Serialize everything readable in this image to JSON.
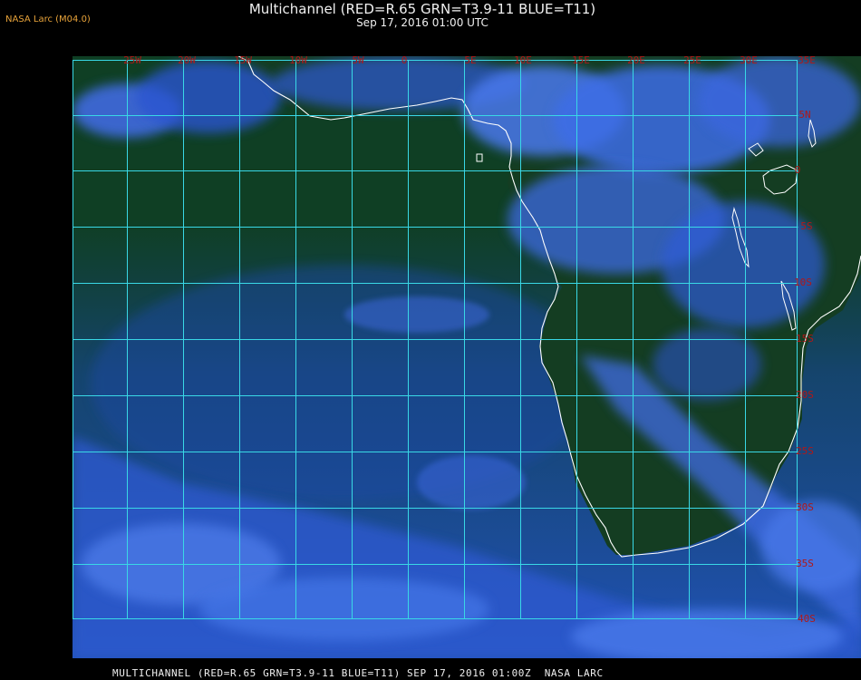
{
  "header": {
    "logo": "NASA Larc (M04.0)",
    "title": "Multichannel (RED=R.65 GRN=T3.9-11 BLUE=T11)",
    "subtitle": "Sep 17, 2016 01:00 UTC"
  },
  "map": {
    "lon_labels": [
      "25W",
      "20W",
      "15W",
      "10W",
      "5W",
      "0",
      "5E",
      "10E",
      "15E",
      "20E",
      "25E",
      "30E",
      "35E"
    ],
    "lat_labels": [
      "5N",
      "0",
      "5S",
      "10S",
      "15S",
      "20S",
      "25S",
      "30S",
      "35S",
      "40S"
    ],
    "colors": {
      "ocean": "#0f3f24",
      "land": "#123a1f",
      "cloud_low": "#1d46b8",
      "cloud_high": "#4d7ae8",
      "grid": "#39d8e6",
      "label": "#b01818",
      "coast": "#ffffff"
    }
  },
  "footer": {
    "caption": "MULTICHANNEL (RED=R.65 GRN=T3.9-11 BLUE=T11) SEP 17, 2016 01:00Z  NASA LARC"
  }
}
